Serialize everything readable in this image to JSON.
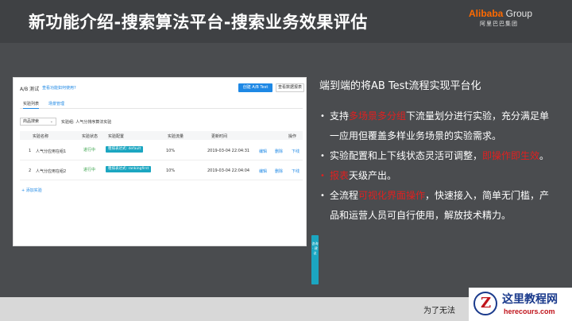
{
  "slide": {
    "title": "新功能介绍-搜索算法平台-搜索业务效果评估",
    "brand": {
      "logo_a": "Alibaba",
      "logo_b": " Group",
      "logo_cn": "阿里巴巴集团"
    }
  },
  "panel": {
    "title": "A/B 测试",
    "link": "查看功能如何使用?",
    "create_button": "创建 A/B Test",
    "view_button": "查看数据报表",
    "tabs": [
      "实验列表",
      "场景管理"
    ],
    "select_value": "商品搜索",
    "experiment_label": "实验组: 人气分排序算法实验",
    "columns": [
      "实验名称",
      "实验状态",
      "实验配置",
      "实验流量",
      "更新时间",
      "操作"
    ],
    "rows": [
      {
        "index": "1",
        "name": "人气分应用在组1",
        "status": "进行中",
        "config": "粗排表达式: default",
        "traffic": "10%",
        "time": "2019-03-04 22:04:31",
        "edit": "编辑",
        "delete": "删除",
        "offline": "下线"
      },
      {
        "index": "2",
        "name": "人气分应用在组2",
        "status": "进行中",
        "config": "粗排表达式: rankingfirst",
        "traffic": "10%",
        "time": "2019-03-04 22:04:04",
        "edit": "编辑",
        "delete": "删除",
        "offline": "下线"
      }
    ],
    "add_label": "+ 添加实验",
    "side_float": "咨询 · 建议"
  },
  "right": {
    "heading": "端到端的将AB Test流程实现平台化",
    "b1_pre": "支持",
    "b1_hl": "多场景多分组",
    "b1_post": "下流量划分进行实验，充分满足单一应用但覆盖多样业务场景的实验需求。",
    "b2_pre": "实验配置和上下线状态灵活可调整，",
    "b2_hl": "即操作即生效",
    "b2_post": "。",
    "b3_hl": "报表",
    "b3_post": "天级产出。",
    "b4_pre": "全流程",
    "b4_hl": "可视化界面操作",
    "b4_post": "，快速接入，简单无门槛，产品和运营人员可自行使用，解放技术精力。"
  },
  "footer": {
    "text": "为了无法"
  },
  "watermark": {
    "letter": "Z",
    "cn": "这里教程网",
    "en": "herecours.com"
  }
}
